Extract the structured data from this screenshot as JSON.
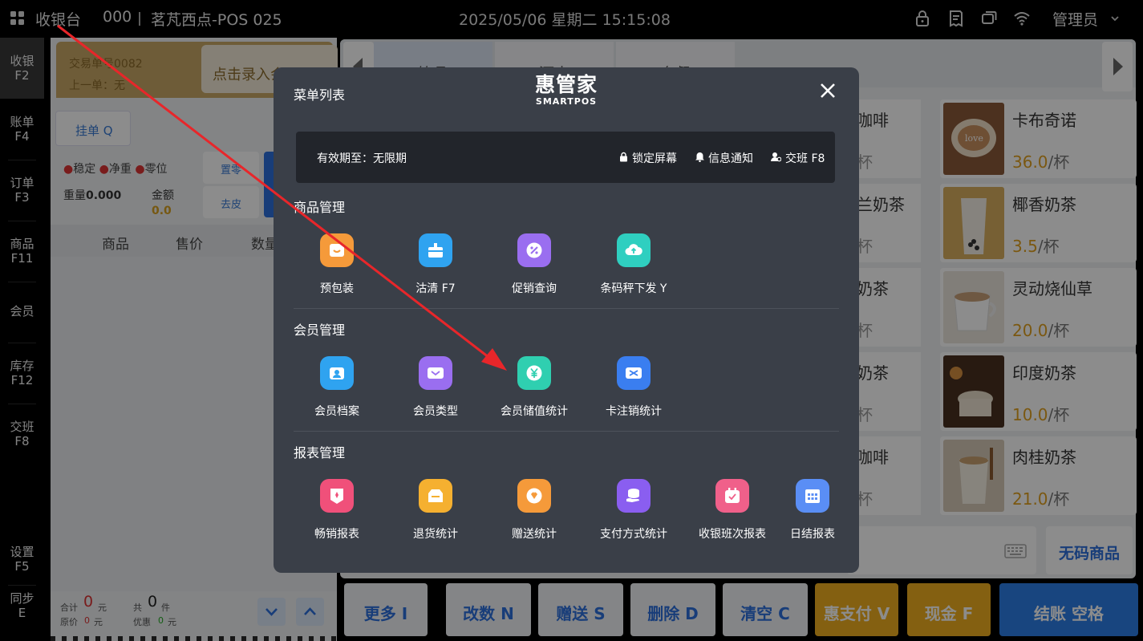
{
  "topbar": {
    "title": "收银台",
    "code": "000",
    "store": "茗芃西点-POS 025",
    "datetime": "2025/05/06 星期二 15:15:08",
    "user": "管理员"
  },
  "nav": {
    "items": [
      {
        "label": "收银",
        "key": "F2"
      },
      {
        "label": "账单",
        "key": "F4"
      },
      {
        "label": "订单",
        "key": "F3"
      },
      {
        "label": "商品",
        "key": "F11"
      },
      {
        "label": "会员",
        "key": ""
      },
      {
        "label": "库存",
        "key": "F12"
      },
      {
        "label": "交班",
        "key": "F8"
      },
      {
        "label": "设置",
        "key": "F5"
      },
      {
        "label": "同步",
        "key": "E"
      }
    ]
  },
  "cart": {
    "order_no": "交易单号0082",
    "prev_order": "上一单：无",
    "member_btn": "点击录入会员",
    "hold_btn": "挂单 Q",
    "flags": [
      "稳定",
      "净重",
      "零位"
    ],
    "weight_label": "重量",
    "weight_value": "0.000",
    "amount_label": "金额",
    "amount_value": "0.0",
    "zero_btn": "置零",
    "tare_btn": "去皮",
    "columns": [
      "商品",
      "售价",
      "数量"
    ],
    "footer": {
      "total_label": "合计",
      "total_value": "0",
      "yuan": "元",
      "count_label": "共",
      "count_value": "0",
      "count_unit": "件",
      "orig_label": "原价",
      "orig_value": "0",
      "discount_label": "优惠",
      "discount_value": "0"
    }
  },
  "catalog": {
    "tabs": [
      "饮品",
      "酒水",
      "套餐"
    ],
    "fragments": [
      {
        "name": "咖啡",
        "unit": "杯"
      },
      {
        "name": "兰奶茶",
        "unit": "杯"
      },
      {
        "name": "奶茶",
        "unit": "杯"
      },
      {
        "name": "奶茶",
        "unit": "杯"
      },
      {
        "name": "咖啡",
        "unit": "杯"
      }
    ],
    "products": [
      {
        "name": "卡布奇诺",
        "price": "36.0",
        "unit": "/杯"
      },
      {
        "name": "椰香奶茶",
        "price": "3.5",
        "unit": "/杯"
      },
      {
        "name": "灵动烧仙草",
        "price": "20.0",
        "unit": "/杯"
      },
      {
        "name": "印度奶茶",
        "price": "10.0",
        "unit": "/杯"
      },
      {
        "name": "肉桂奶茶",
        "price": "21.0",
        "unit": "/杯"
      }
    ],
    "no_code_btn": "无码商品"
  },
  "actions": [
    {
      "label": "更多 I",
      "style": "white"
    },
    {
      "label": "改数 N",
      "style": "white"
    },
    {
      "label": "赠送 S",
      "style": "white"
    },
    {
      "label": "删除 D",
      "style": "white"
    },
    {
      "label": "清空 C",
      "style": "white"
    },
    {
      "label": "惠支付 V",
      "style": "orange"
    },
    {
      "label": "现金 F",
      "style": "orange"
    },
    {
      "label": "结账 空格",
      "style": "blue"
    }
  ],
  "modal": {
    "title": "菜单列表",
    "logo_cn": "惠管家",
    "logo_en": "SMARTPOS",
    "validity": "有效期至：无限期",
    "links": [
      "锁定屏幕",
      "信息通知",
      "交班 F8"
    ],
    "sections": [
      {
        "title": "商品管理",
        "items": [
          {
            "label": "预包装",
            "color": "#f59a3a",
            "icon": "package-icon"
          },
          {
            "label": "沽清 F7",
            "color": "#2fa3f0",
            "icon": "sellout-icon"
          },
          {
            "label": "促销查询",
            "color": "#9a6ef0",
            "icon": "discount-icon"
          },
          {
            "label": "条码秤下发 Y",
            "color": "#2fcfc0",
            "icon": "cloud-upload-icon"
          }
        ]
      },
      {
        "title": "会员管理",
        "items": [
          {
            "label": "会员档案",
            "color": "#2fa3f0",
            "icon": "member-file-icon"
          },
          {
            "label": "会员类型",
            "color": "#9a6ef0",
            "icon": "member-card-icon"
          },
          {
            "label": "会员储值统计",
            "color": "#2fcfb0",
            "icon": "yuan-coin-icon"
          },
          {
            "label": "卡注销统计",
            "color": "#3a7ef0",
            "icon": "card-cancel-icon"
          }
        ]
      },
      {
        "title": "报表管理",
        "items": [
          {
            "label": "畅销报表",
            "color": "#f0507a",
            "icon": "hot-sale-icon"
          },
          {
            "label": "退货统计",
            "color": "#f5b030",
            "icon": "return-icon"
          },
          {
            "label": "赠送统计",
            "color": "#f59a3a",
            "icon": "gift-icon"
          },
          {
            "label": "支付方式统计",
            "color": "#8a5ef0",
            "icon": "payment-icon"
          },
          {
            "label": "收银班次报表",
            "color": "#f0608a",
            "icon": "calendar-icon"
          },
          {
            "label": "日结报表",
            "color": "#5a8ef5",
            "icon": "daily-report-icon"
          }
        ]
      }
    ]
  }
}
